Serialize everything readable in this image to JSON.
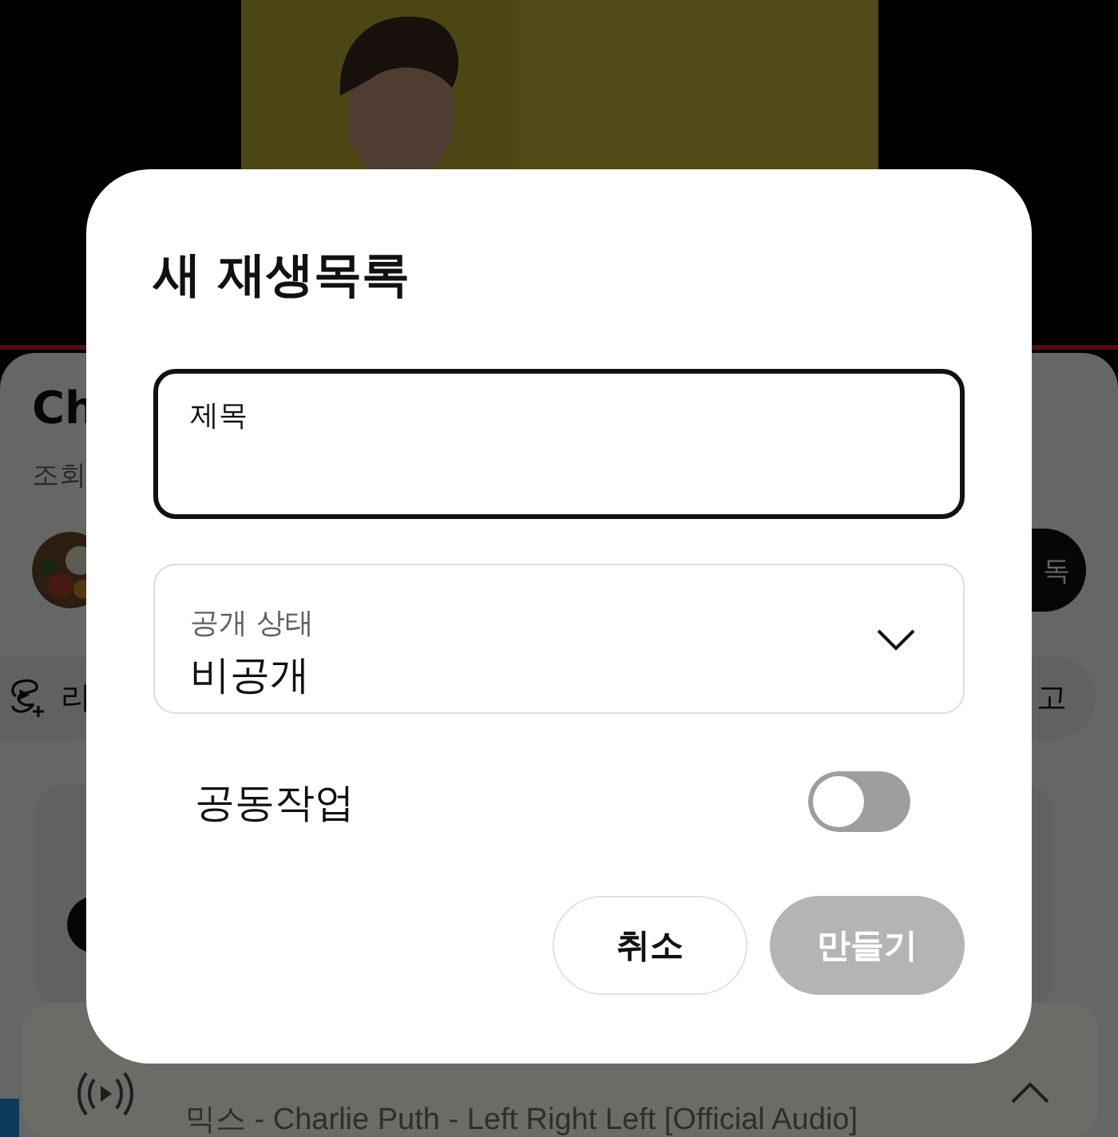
{
  "video_info": {
    "title": "Ch",
    "views": "조회"
  },
  "channel": {
    "subscribe_button": "독"
  },
  "actions": [
    {
      "label": "리"
    },
    {
      "label": "고"
    }
  ],
  "mini_player": {
    "subtitle": "믹스 - Charlie Puth - Left Right Left [Official Audio]"
  },
  "dialog": {
    "title": "새 재생목록",
    "title_field": {
      "label": "제목"
    },
    "visibility": {
      "label": "공개 상태",
      "value": "비공개"
    },
    "collaborate": {
      "label": "공동작업",
      "on": false
    },
    "buttons": [
      {
        "label": "취소",
        "kind": "secondary",
        "disabled": false
      },
      {
        "label": "만들기",
        "kind": "primary",
        "disabled": true
      }
    ]
  }
}
